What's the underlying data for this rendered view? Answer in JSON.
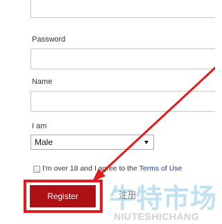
{
  "form": {
    "password_label": "Password",
    "name_label": "Name",
    "iam_label": "I am",
    "gender_select": {
      "value": "Male"
    },
    "agree_text": "I'm over 18 and I agree to the",
    "terms_link": "Terms of Use",
    "register_label": "Register"
  },
  "annotation": {
    "highlight_color": "#e11b1b",
    "arrow_color": "#e11b1b"
  },
  "watermark": {
    "chinese": "牛特市场",
    "latin": "NIUTESHICHANG",
    "overlay": "注册"
  }
}
